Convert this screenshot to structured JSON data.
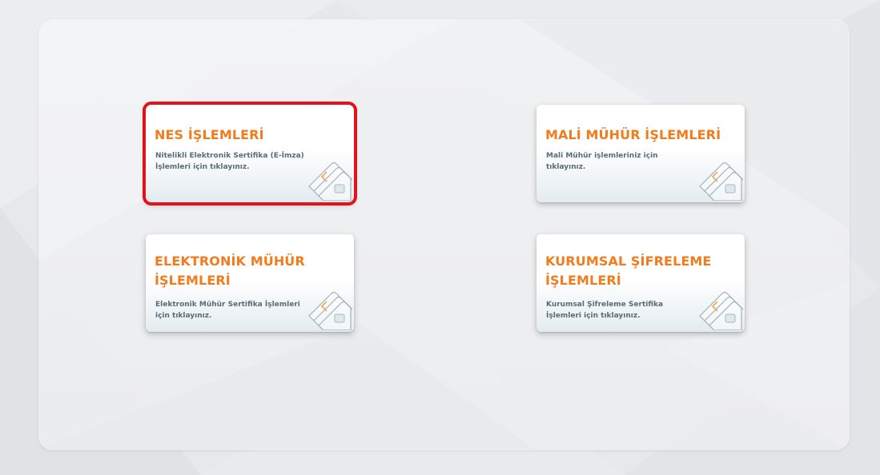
{
  "cards": [
    {
      "title": "NES İŞLEMLERİ",
      "desc_line1": "Nitelikli Elektronik Sertifika (E-İmza)",
      "desc_line2": "İşlemleri için tıklayınız.",
      "selected": true
    },
    {
      "title": "MALİ MÜHÜR İŞLEMLERİ",
      "desc_line1": "Mali Mühür işlemleriniz için",
      "desc_line2": "tıklayınız.",
      "selected": false
    },
    {
      "title_line1": "ELEKTRONİK MÜHÜR",
      "title_line2": "İŞLEMLERİ",
      "desc_line1": "Elektronik Mühür Sertifika İşlemleri",
      "desc_line2": "için tıklayınız.",
      "selected": false
    },
    {
      "title_line1": "KURUMSAL ŞİFRELEME",
      "title_line2": "İŞLEMLERİ",
      "desc_line1": "Kurumsal Şifreleme Sertifika",
      "desc_line2": "İşlemleri için tıklayınız.",
      "selected": false
    }
  ],
  "colors": {
    "title": "#f07c1e",
    "description": "#5b6b74",
    "selection_outline": "#e2121b",
    "icon_chevron": "#f5a54a",
    "icon_stroke": "#9fb2bb"
  },
  "icons": {
    "card_icon": "smart-card-stack-icon"
  }
}
